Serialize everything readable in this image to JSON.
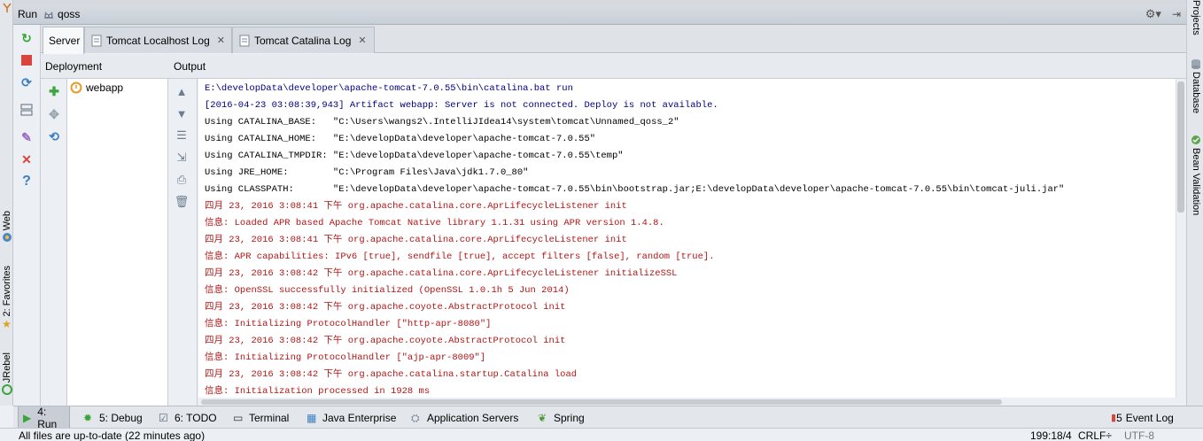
{
  "header": {
    "run_label": "Run",
    "config_name": "qoss"
  },
  "left_strip": {
    "web": "Web",
    "favorites": "2: Favorites",
    "jrebel": "JRebel"
  },
  "right_strip": {
    "projects": "Projects",
    "database": "Database",
    "bean_validation": "Bean Validation"
  },
  "tabs": [
    {
      "label": "Server"
    },
    {
      "label": "Tomcat Localhost Log"
    },
    {
      "label": "Tomcat Catalina Log"
    }
  ],
  "columns": {
    "deployment": "Deployment",
    "output": "Output"
  },
  "deployment": {
    "items": [
      {
        "label": "webapp"
      }
    ]
  },
  "console": {
    "lines": [
      {
        "text": "E:\\developData\\developer\\apache-tomcat-7.0.55\\bin\\catalina.bat run",
        "kind": "sys"
      },
      {
        "text": "[2016-04-23 03:08:39,943] Artifact webapp: Server is not connected. Deploy is not available.",
        "kind": "sys"
      },
      {
        "text": "Using CATALINA_BASE:   \"C:\\Users\\wangs2\\.IntelliJIdea14\\system\\tomcat\\Unnamed_qoss_2\"",
        "kind": "plain"
      },
      {
        "text": "Using CATALINA_HOME:   \"E:\\developData\\developer\\apache-tomcat-7.0.55\"",
        "kind": "plain"
      },
      {
        "text": "Using CATALINA_TMPDIR: \"E:\\developData\\developer\\apache-tomcat-7.0.55\\temp\"",
        "kind": "plain"
      },
      {
        "text": "Using JRE_HOME:        \"C:\\Program Files\\Java\\jdk1.7.0_80\"",
        "kind": "plain"
      },
      {
        "text": "Using CLASSPATH:       \"E:\\developData\\developer\\apache-tomcat-7.0.55\\bin\\bootstrap.jar;E:\\developData\\developer\\apache-tomcat-7.0.55\\bin\\tomcat-juli.jar\"",
        "kind": "plain"
      },
      {
        "text": "四月 23, 2016 3:08:41 下午 org.apache.catalina.core.AprLifecycleListener init",
        "kind": "err"
      },
      {
        "text": "信息: Loaded APR based Apache Tomcat Native library 1.1.31 using APR version 1.4.8.",
        "kind": "err"
      },
      {
        "text": "四月 23, 2016 3:08:41 下午 org.apache.catalina.core.AprLifecycleListener init",
        "kind": "err"
      },
      {
        "text": "信息: APR capabilities: IPv6 [true], sendfile [true], accept filters [false], random [true].",
        "kind": "err"
      },
      {
        "text": "四月 23, 2016 3:08:42 下午 org.apache.catalina.core.AprLifecycleListener initializeSSL",
        "kind": "err"
      },
      {
        "text": "信息: OpenSSL successfully initialized (OpenSSL 1.0.1h 5 Jun 2014)",
        "kind": "err"
      },
      {
        "text": "四月 23, 2016 3:08:42 下午 org.apache.coyote.AbstractProtocol init",
        "kind": "err"
      },
      {
        "text": "信息: Initializing ProtocolHandler [\"http-apr-8080\"]",
        "kind": "err"
      },
      {
        "text": "四月 23, 2016 3:08:42 下午 org.apache.coyote.AbstractProtocol init",
        "kind": "err"
      },
      {
        "text": "信息: Initializing ProtocolHandler [\"ajp-apr-8009\"]",
        "kind": "err"
      },
      {
        "text": "四月 23, 2016 3:08:42 下午 org.apache.catalina.startup.Catalina load",
        "kind": "err"
      },
      {
        "text": "信息: Initialization processed in 1928 ms",
        "kind": "err"
      }
    ]
  },
  "bottom_bar": {
    "items": [
      {
        "label": "4: Run",
        "icon": "run-icon"
      },
      {
        "label": "5: Debug",
        "icon": "bug-icon"
      },
      {
        "label": "6: TODO",
        "icon": "todo-icon"
      },
      {
        "label": "Terminal",
        "icon": "terminal-icon"
      },
      {
        "label": "Java Enterprise",
        "icon": "java-enterprise-icon"
      },
      {
        "label": "Application Servers",
        "icon": "servers-icon"
      },
      {
        "label": "Spring",
        "icon": "spring-leaf-icon"
      }
    ],
    "event_log_count": "5",
    "event_log": "Event Log"
  },
  "status": {
    "message": "All files are up-to-date (22 minutes ago)",
    "position": "199:18/4",
    "line_separator": "CRLF÷",
    "encoding": "UTF-8"
  }
}
